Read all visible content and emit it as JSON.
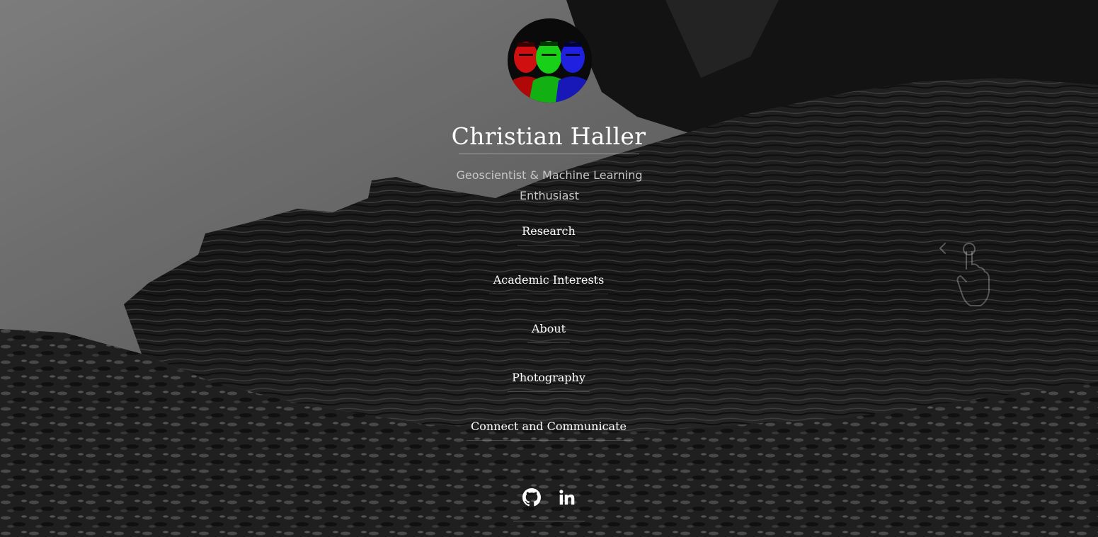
{
  "profile": {
    "name": "Christian Haller",
    "tagline": "Geoscientist & Machine Learning Enthusiast",
    "avatar_icon": "rgb-portrait-avatar"
  },
  "nav": [
    {
      "label": "Research"
    },
    {
      "label": "Academic Interests"
    },
    {
      "label": "About"
    },
    {
      "label": "Photography"
    },
    {
      "label": "Connect and Communicate"
    }
  ],
  "socials": [
    {
      "icon": "github-icon"
    },
    {
      "icon": "linkedin-icon"
    }
  ],
  "hint": {
    "icon": "swipe-left-hand-icon"
  },
  "colors": {
    "text": "#ffffff",
    "tagline": "#c8c8c8",
    "background": "#0b0b0b"
  }
}
